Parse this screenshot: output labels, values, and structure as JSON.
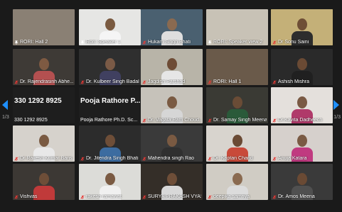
{
  "pagination": {
    "left": "1/3",
    "right": "1/3"
  },
  "tiles": [
    {
      "name": "RORI: Hall 2",
      "kind": "video",
      "pin": true,
      "mute": false,
      "bg": "#8a8074",
      "head": "none",
      "torso": "none"
    },
    {
      "name": "Rori: Speaker 1",
      "kind": "video",
      "pin": true,
      "mute": false,
      "bg": "#e6e6e4",
      "head": "#7a5a40",
      "torso": "#f5f5f5"
    },
    {
      "name": "Hukam Singh Bhati",
      "kind": "video",
      "pin": false,
      "mute": true,
      "bg": "#4a6070",
      "head": "#8a6a50",
      "torso": "#dedede"
    },
    {
      "name": "RORI: Speaker view 2",
      "kind": "video",
      "pin": true,
      "mute": false,
      "bg": "#c8c2b6",
      "head": "none",
      "torso": "none"
    },
    {
      "name": "Dr Sonu Saini",
      "kind": "video",
      "pin": false,
      "mute": true,
      "bg": "#c4b078",
      "head": "#6e4e36",
      "torso": "#2d2d2d",
      "active": true
    },
    {
      "name": "Dr. Rajendrasinh Abhe...",
      "kind": "video",
      "pin": false,
      "mute": true,
      "bg": "#3e3a36",
      "head": "#7e5a42",
      "torso": "#b45050"
    },
    {
      "name": "Dr. Kulbeer Singh Badal",
      "kind": "video",
      "pin": false,
      "mute": true,
      "bg": "#2f2f2f",
      "head": "#7a5a46",
      "torso": "#404060"
    },
    {
      "name": "Jagdish Parshad",
      "kind": "video",
      "pin": false,
      "mute": true,
      "bg": "#b8b4a8",
      "head": "#6e4c36",
      "torso": "#e6e6e6"
    },
    {
      "name": "RORI: Hall 1",
      "kind": "video",
      "pin": false,
      "mute": true,
      "bg": "#6a5a4a",
      "head": "none",
      "torso": "none"
    },
    {
      "name": "Ashish Mishra",
      "kind": "video",
      "pin": false,
      "mute": true,
      "bg": "#2a2a2a",
      "head": "#6a4a34",
      "torso": "#202020"
    },
    {
      "name": "330 1292 8925",
      "kind": "number",
      "big": "330 1292 8925",
      "pin": false,
      "mute": false,
      "bg": "#1e1e1e"
    },
    {
      "name": "Pooja Rathore Ph.D. Sc...",
      "kind": "number",
      "big": "Pooja Rathore P...",
      "pin": false,
      "mute": false,
      "bg": "#1e1e1e"
    },
    {
      "name": "Dr. Vagata Ram Choud...",
      "kind": "video",
      "pin": false,
      "mute": true,
      "bg": "#c6c2ba",
      "head": "#7a5a42",
      "torso": "#d6d6d6"
    },
    {
      "name": "Dr. Samay Singh Meena",
      "kind": "video",
      "pin": false,
      "mute": true,
      "bg": "#3a3a34",
      "head": "#6a4c36",
      "torso": "#2a5a3a"
    },
    {
      "name": "Dr.Kavita Dadheech",
      "kind": "video",
      "pin": false,
      "mute": true,
      "bg": "#e4e0dc",
      "head": "#7a5a44",
      "torso": "#b03a6a"
    },
    {
      "name": "Dr Rakesh Kumar Bans...",
      "kind": "video",
      "pin": false,
      "mute": true,
      "bg": "#d6d2cc",
      "head": "#7a5a42",
      "torso": "#e8e8e8"
    },
    {
      "name": "Dr. Jitendra Singh Bhati",
      "kind": "video",
      "pin": false,
      "mute": true,
      "bg": "#2c2c2c",
      "head": "#6e4e38",
      "torso": "#3c6ca0"
    },
    {
      "name": "Mahendra singh Rao",
      "kind": "video",
      "pin": false,
      "mute": true,
      "bg": "#3a3a3a",
      "head": "#7a5a42",
      "torso": "#303030"
    },
    {
      "name": "Dr. Kaptan Chand",
      "kind": "video",
      "pin": false,
      "mute": true,
      "bg": "#d8d4ce",
      "head": "#6a4a34",
      "torso": "#c84a3a"
    },
    {
      "name": "Anuja Katara",
      "kind": "video",
      "pin": false,
      "mute": true,
      "bg": "#d6d0cc",
      "head": "#7a5a44",
      "torso": "#c03a80"
    },
    {
      "name": "Vishvas",
      "kind": "video",
      "pin": false,
      "mute": true,
      "bg": "#3c3834",
      "head": "#6e4e38",
      "torso": "#c03a3a"
    },
    {
      "name": "rakesh ramawat",
      "kind": "video",
      "pin": false,
      "mute": true,
      "bg": "#dcdcd8",
      "head": "#7a5a42",
      "torso": "#f0f0f0"
    },
    {
      "name": "SURYA PRAKASH VYAS",
      "kind": "video",
      "pin": false,
      "mute": true,
      "bg": "#342e28",
      "head": "#6e4e38",
      "torso": "#d8d8d8"
    },
    {
      "name": "deepika samriya",
      "kind": "video",
      "pin": false,
      "mute": true,
      "bg": "#d0ccc4",
      "head": "#8a6a50",
      "torso": "#dcdcdc"
    },
    {
      "name": "Dr. Amos Meena",
      "kind": "video",
      "pin": false,
      "mute": true,
      "bg": "#3a3a3a",
      "head": "#6a4a34",
      "torso": "#505050"
    }
  ],
  "colors": {
    "background": "#1a1a1a",
    "active_outline": "#c9d600",
    "nav_arrow": "#1e8fff",
    "mute_icon": "#e53935",
    "pin_icon": "#ffffff"
  },
  "icons": {
    "pin": "pin-icon",
    "mute": "microphone-muted-icon",
    "prev": "chevron-left-icon",
    "next": "chevron-right-icon"
  }
}
